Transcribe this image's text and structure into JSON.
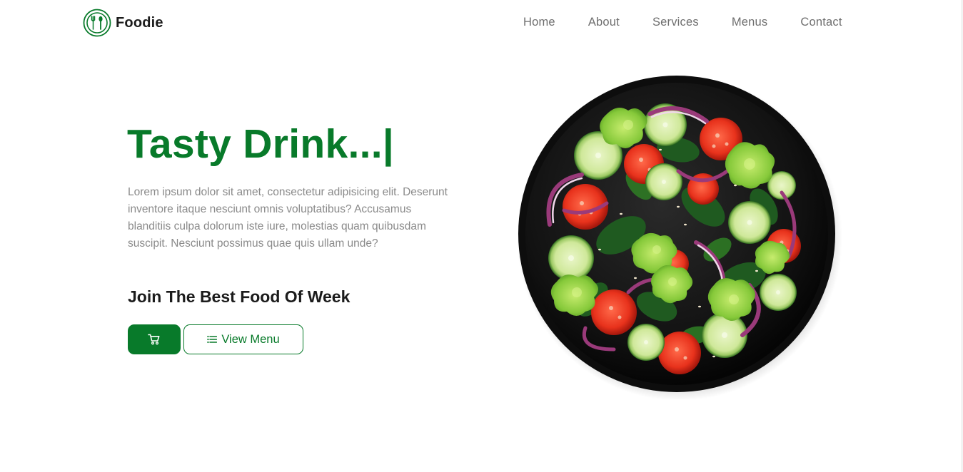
{
  "brand": {
    "name": "Foodie",
    "logo_icon": "fork-spoon-icon",
    "accent_color": "#087a2a"
  },
  "nav": {
    "items": [
      {
        "label": "Home"
      },
      {
        "label": "About"
      },
      {
        "label": "Services"
      },
      {
        "label": "Menus"
      },
      {
        "label": "Contact"
      }
    ]
  },
  "hero": {
    "title": "Tasty Drink...|",
    "description": "Lorem ipsum dolor sit amet, consectetur adipisicing elit. Deserunt inventore itaque nesciunt omnis voluptatibus? Accusamus blanditiis culpa dolorum iste iure, molestias quam quibusdam suscipit. Nesciunt possimus quae quis ullam unde?",
    "subtitle": "Join The Best Food Of Week",
    "cart_button_icon": "shopping-cart-icon",
    "menu_button_icon": "list-icon",
    "menu_button_label": "View Menu",
    "image_subject": "salad-bowl"
  }
}
